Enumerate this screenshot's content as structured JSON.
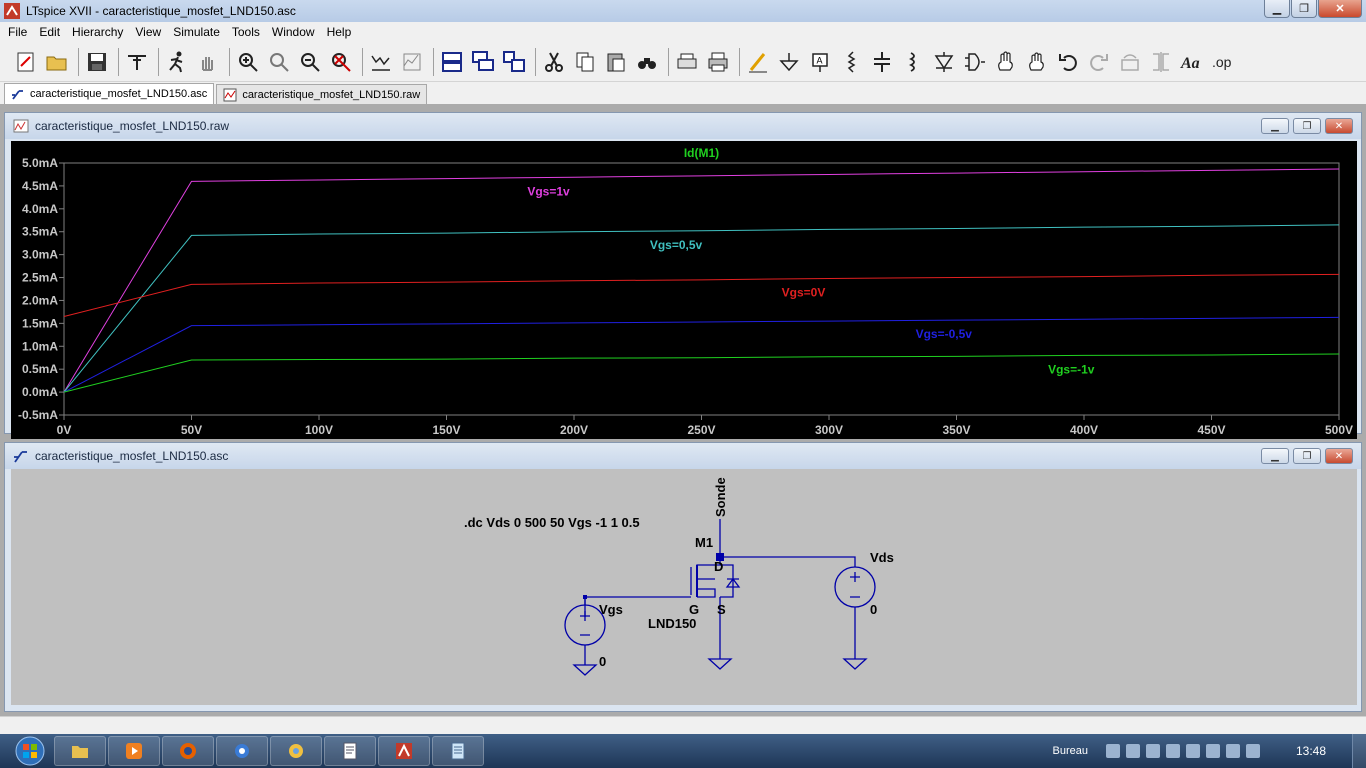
{
  "window": {
    "title": "LTspice XVII - caracteristique_mosfet_LND150.asc"
  },
  "menu": [
    "File",
    "Edit",
    "Hierarchy",
    "View",
    "Simulate",
    "Tools",
    "Window",
    "Help"
  ],
  "toolbar_icons": [
    "new-schematic-icon",
    "open-icon",
    "save-icon",
    "control-panel-icon",
    "run-icon",
    "halt-icon",
    "zoom-in-icon",
    "zoom-pan-icon",
    "zoom-out-icon",
    "zoom-fit-icon",
    "autorange-icon",
    "zoom-back-icon",
    "tile-horizontal-icon",
    "cascade-icon",
    "tile-vertical-icon",
    "cut-icon",
    "copy-icon",
    "paste-icon",
    "find-icon",
    "print-preview-icon",
    "print-icon",
    "draw-wire-icon",
    "ground-icon",
    "label-net-icon",
    "resistor-icon",
    "capacitor-icon",
    "inductor-icon",
    "diode-icon",
    "component-icon",
    "move-icon",
    "drag-icon",
    "undo-icon",
    "redo-icon",
    "rotate-icon",
    "mirror-icon",
    "text-icon",
    "spice-directive-icon"
  ],
  "tabs": [
    {
      "label": "caracteristique_mosfet_LND150.asc",
      "active": true
    },
    {
      "label": "caracteristique_mosfet_LND150.raw",
      "active": false
    }
  ],
  "waveform_window": {
    "title": "caracteristique_mosfet_LND150.raw"
  },
  "schematic_window": {
    "title": "caracteristique_mosfet_LND150.asc"
  },
  "chart_data": {
    "type": "line",
    "title": "Id(M1)",
    "x": [
      0,
      50,
      100,
      150,
      200,
      250,
      300,
      350,
      400,
      450,
      500
    ],
    "xlim": [
      0,
      500
    ],
    "ylim": [
      -0.5,
      5.0
    ],
    "x_ticks": [
      "0V",
      "50V",
      "100V",
      "150V",
      "200V",
      "250V",
      "300V",
      "350V",
      "400V",
      "450V",
      "500V"
    ],
    "y_ticks": [
      "5.0mA",
      "4.5mA",
      "4.0mA",
      "3.5mA",
      "3.0mA",
      "2.5mA",
      "2.0mA",
      "1.5mA",
      "1.0mA",
      "0.5mA",
      "0.0mA",
      "-0.5mA"
    ],
    "y_tick_values": [
      5.0,
      4.5,
      4.0,
      3.5,
      3.0,
      2.5,
      2.0,
      1.5,
      1.0,
      0.5,
      0.0,
      -0.5
    ],
    "background": "#000000",
    "series": [
      {
        "name": "Vgs=1v",
        "color": "#e040e0",
        "values": [
          0,
          4.6,
          4.63,
          4.66,
          4.69,
          4.72,
          4.75,
          4.78,
          4.81,
          4.84,
          4.87
        ]
      },
      {
        "name": "Vgs=0,5v",
        "color": "#40c0c0",
        "values": [
          0,
          3.42,
          3.45,
          3.47,
          3.5,
          3.52,
          3.55,
          3.57,
          3.6,
          3.62,
          3.65
        ]
      },
      {
        "name": "Vgs=0V",
        "color": "#e02020",
        "values": [
          1.65,
          2.35,
          2.38,
          2.4,
          2.43,
          2.45,
          2.48,
          2.5,
          2.52,
          2.55,
          2.57
        ]
      },
      {
        "name": "Vgs=-0,5v",
        "color": "#2020e0",
        "values": [
          0,
          1.45,
          1.47,
          1.49,
          1.51,
          1.53,
          1.55,
          1.57,
          1.59,
          1.61,
          1.63
        ]
      },
      {
        "name": "Vgs=-1v",
        "color": "#20d020",
        "values": [
          0,
          0.7,
          0.71,
          0.72,
          0.74,
          0.75,
          0.77,
          0.78,
          0.8,
          0.81,
          0.83
        ]
      }
    ]
  },
  "schematic": {
    "directive": ".dc Vds 0 500 50 Vgs -1 1 0.5",
    "probe_label": "Sonde",
    "mosfet_name": "M1",
    "mosfet_model": "LND150",
    "pin_d": "D",
    "pin_g": "G",
    "pin_s": "S",
    "vgs_name": "Vgs",
    "vgs_value": "0",
    "vds_name": "Vds",
    "vds_value": "0",
    "wire_color": "#0000a8"
  },
  "taskbar": {
    "desktop_label": "Bureau",
    "clock": "13:48"
  }
}
